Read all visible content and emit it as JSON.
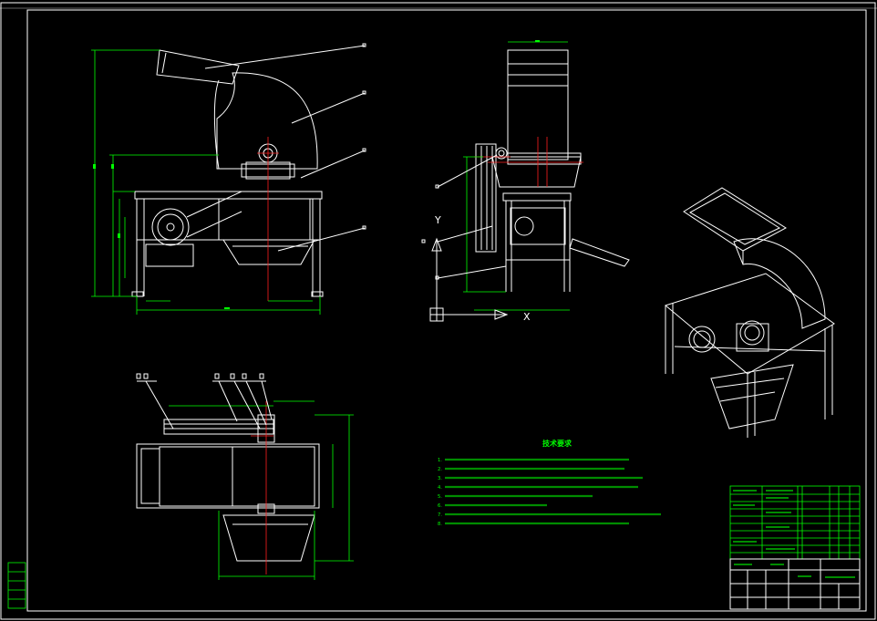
{
  "drawing": {
    "technical_requirements_title": "技术要求",
    "technical_requirements": [
      "1.",
      "2.",
      "3.",
      "4.",
      "5.",
      "6.",
      "7.",
      "8."
    ],
    "axis_labels": {
      "y": "Y",
      "x": "X"
    },
    "colors": {
      "background": "#000000",
      "outline": "#ffffff",
      "dimension": "#00ff00",
      "centerline": "#ff2020"
    }
  }
}
